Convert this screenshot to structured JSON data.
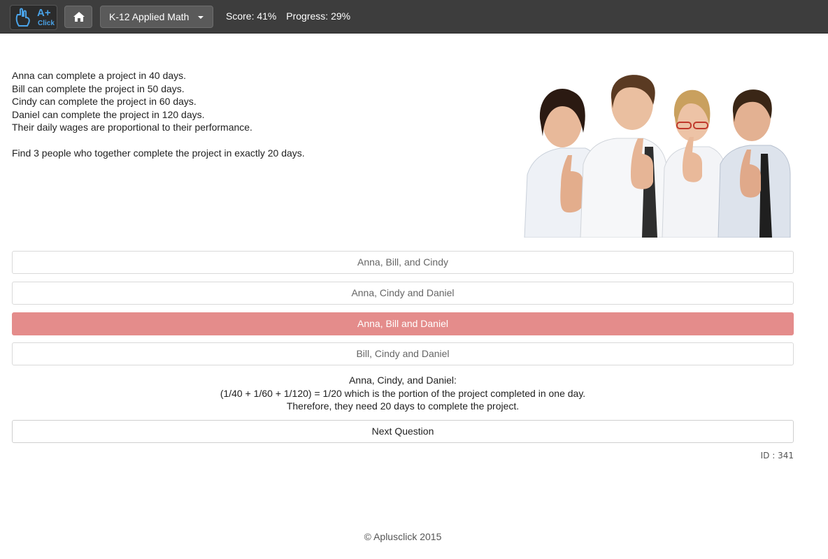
{
  "header": {
    "logo_text": "A+",
    "logo_sub": "Click",
    "course": "K-12 Applied Math",
    "score": "Score: 41%",
    "progress": "Progress: 29%"
  },
  "question": {
    "lines": [
      "Anna can complete a project in 40 days.",
      "Bill can complete the project in 50 days.",
      "Cindy can complete the project in 60 days.",
      "Daniel can complete the project in 120 days.",
      "Their daily wages are proportional to their performance."
    ],
    "prompt": "Find 3 people who together complete the project in exactly 20 days."
  },
  "choices": [
    {
      "label": "Anna, Bill, and Cindy",
      "state": "normal"
    },
    {
      "label": "Anna, Cindy and Daniel",
      "state": "normal"
    },
    {
      "label": "Anna, Bill and Daniel",
      "state": "wrong"
    },
    {
      "label": "Bill, Cindy and Daniel",
      "state": "normal"
    }
  ],
  "explanation": [
    "Anna, Cindy, and Daniel:",
    "(1/40 + 1/60 + 1/120) = 1/20 which is the portion of the project completed in one day.",
    "Therefore, they need 20 days to complete the project."
  ],
  "next_label": "Next Question",
  "question_id": "ID : 341",
  "footer": "© Aplusclick 2015",
  "colors": {
    "topbar": "#3d3d3d",
    "accent": "#4aa3e8",
    "wrong_choice": "#e48c8b"
  }
}
